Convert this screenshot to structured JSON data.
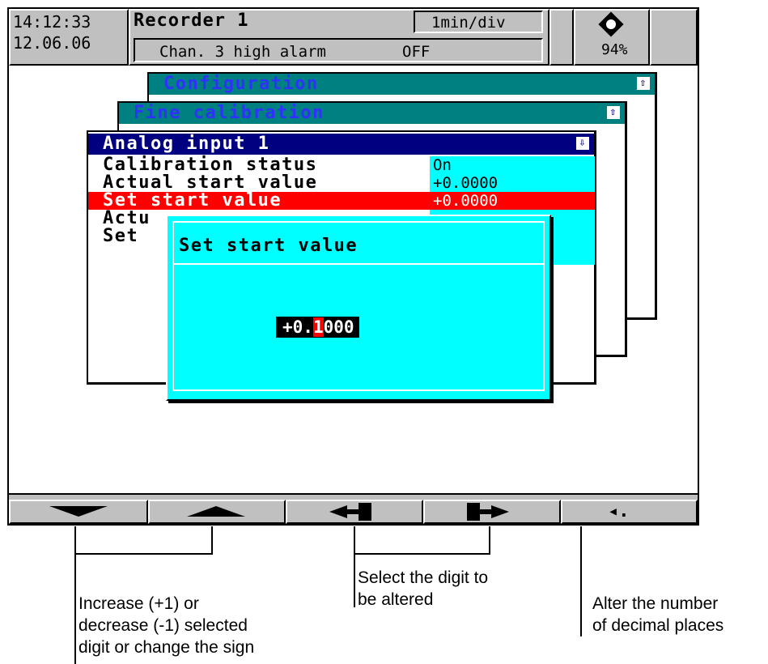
{
  "status_bar": {
    "time": "14:12:33",
    "date": "12.06.06",
    "title": "Recorder 1",
    "timebase": "1min/div",
    "message": "Chan. 3 high alarm",
    "message_state": "OFF",
    "storage_percent": "94%",
    "storage_icon": "cf-card-icon"
  },
  "menus": {
    "configuration": {
      "title": "Configuration",
      "icon": "up-arrow-icon"
    },
    "fine_calibration": {
      "title": "Fine calibration",
      "icon": "up-arrow-icon"
    },
    "analog_input": {
      "title": "Analog input 1",
      "icon": "down-arrow-icon",
      "rows": [
        {
          "label": "Calibration status",
          "value": "On"
        },
        {
          "label": "Actual start value",
          "value": "+0.0000"
        },
        {
          "label": "Set start value",
          "value": "+0.0000"
        },
        {
          "label": "Actu",
          "value": ""
        },
        {
          "label": "Set",
          "value": ""
        }
      ]
    }
  },
  "dialog": {
    "title": "Set start value",
    "value_prefix": "+0.",
    "value_selected_digit": "1",
    "value_suffix": "000"
  },
  "softkeys": [
    {
      "name": "decrease",
      "icon": "triangle-down-icon"
    },
    {
      "name": "increase",
      "icon": "triangle-up-icon"
    },
    {
      "name": "cursor-left",
      "icon": "arrow-left-icon"
    },
    {
      "name": "cursor-right",
      "icon": "arrow-right-icon"
    },
    {
      "name": "decimal-places",
      "icon": "decimal-point-icon",
      "label": "◂."
    }
  ],
  "annotations": {
    "increase_decrease": [
      "Increase (+1) or",
      "decrease (-1) selected",
      "digit or change the sign"
    ],
    "select_digit": [
      "Select the digit to",
      "be altered"
    ],
    "decimal_places": [
      "Alter the number",
      "of decimal places"
    ]
  }
}
